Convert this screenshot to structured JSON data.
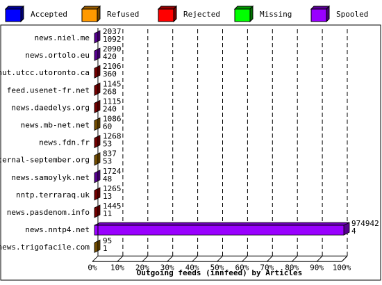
{
  "legend": [
    {
      "label": "Accepted",
      "color": "#0000ff"
    },
    {
      "label": "Refused",
      "color": "#ff9900"
    },
    {
      "label": "Rejected",
      "color": "#ff0000"
    },
    {
      "label": "Missing",
      "color": "#00ff00"
    },
    {
      "label": "Spooled",
      "color": "#9900ff"
    }
  ],
  "chart_data": {
    "type": "bar",
    "orientation": "horizontal",
    "xlabel": "Outgoing feeds (innfeed) by Articles",
    "xticks": [
      "0%",
      "10%",
      "20%",
      "30%",
      "40%",
      "50%",
      "60%",
      "70%",
      "80%",
      "90%",
      "100%"
    ],
    "xlim": [
      0,
      100
    ],
    "grid": true,
    "legend_position": "top",
    "series_names": [
      "Accepted",
      "Refused",
      "Rejected",
      "Missing",
      "Spooled"
    ],
    "rows": [
      {
        "server": "news.niel.me",
        "count1": "2037",
        "count2": "1092",
        "color": "#9900ff",
        "percent": 0
      },
      {
        "server": "news.ortolo.eu",
        "count1": "2090",
        "count2": "420",
        "color": "#9900ff",
        "percent": 0
      },
      {
        "server": "nut.utcc.utoronto.ca",
        "count1": "2106",
        "count2": "360",
        "color": "#cc0000",
        "percent": 0
      },
      {
        "server": "feed.usenet-fr.net",
        "count1": "1145",
        "count2": "268",
        "color": "#cc0000",
        "percent": 0
      },
      {
        "server": "news.daedelys.org",
        "count1": "1115",
        "count2": "240",
        "color": "#cc0000",
        "percent": 0
      },
      {
        "server": "news.mb-net.net",
        "count1": "1086",
        "count2": "60",
        "color": "#cc8800",
        "percent": 0
      },
      {
        "server": "news.fdn.fr",
        "count1": "1268",
        "count2": "53",
        "color": "#cc0000",
        "percent": 0
      },
      {
        "server": "eternal-september.org",
        "count1": "837",
        "count2": "53",
        "color": "#cc8800",
        "percent": 0
      },
      {
        "server": "news.samoylyk.net",
        "count1": "1724",
        "count2": "48",
        "color": "#9900ff",
        "percent": 0
      },
      {
        "server": "nntp.terraraq.uk",
        "count1": "1265",
        "count2": "13",
        "color": "#cc0000",
        "percent": 0
      },
      {
        "server": "news.pasdenom.info",
        "count1": "1445",
        "count2": "11",
        "color": "#cc0000",
        "percent": 0
      },
      {
        "server": "news.nntp4.net",
        "count1": "974942",
        "count2": "4",
        "color": "#9900ff",
        "percent": 100
      },
      {
        "server": "news.trigofacile.com",
        "count1": "95",
        "count2": "1",
        "color": "#cc8800",
        "percent": 0
      }
    ]
  }
}
